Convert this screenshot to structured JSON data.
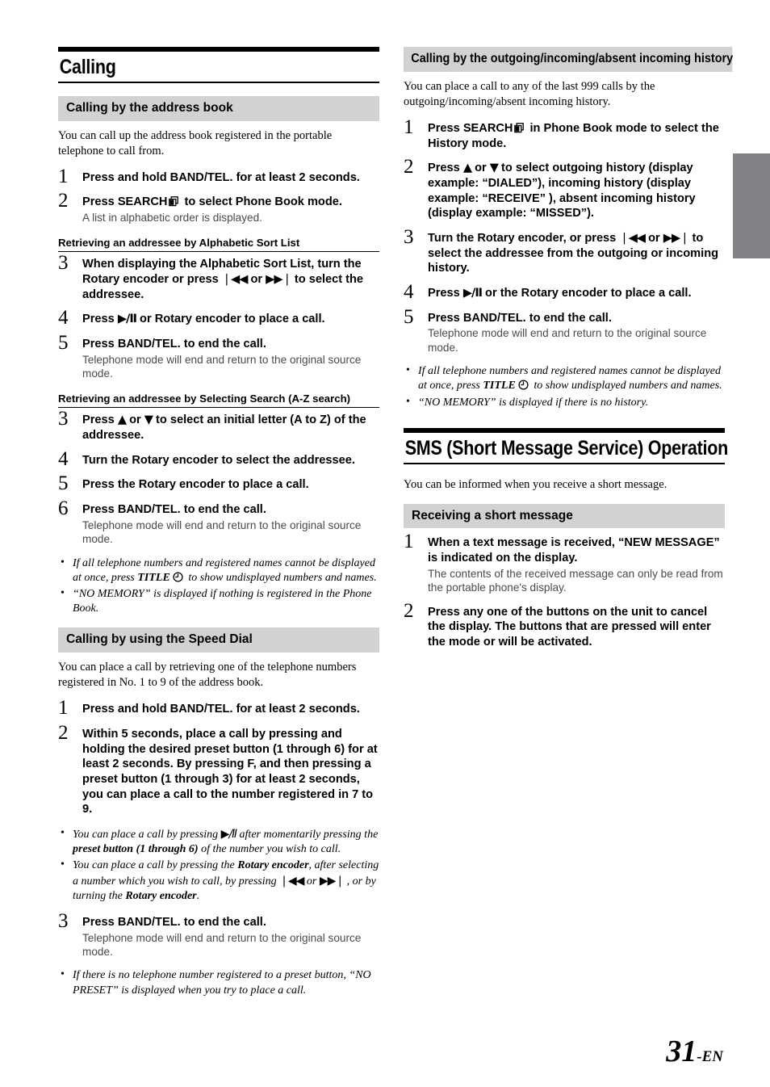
{
  "page": {
    "number": "31",
    "suffix": "-EN",
    "edge_tab_color": "#808288",
    "band_color": "#d2d2d2"
  },
  "left_column": {
    "chapter_title": "Calling",
    "section_address_book": {
      "band": "Calling by the address book",
      "intro": "You can call up the address book registered in the portable telephone to call from.",
      "steps": [
        {
          "num": "1",
          "pre": "Press and hold ",
          "bold": "BAND/TEL.",
          "post": " for at least 2 seconds.",
          "sub": ""
        },
        {
          "num": "2",
          "pre": "Press ",
          "bold": "SEARCH",
          "icon": "search-icon",
          "post": " to select Phone Book mode.",
          "sub": "A list in alphabetic order is displayed."
        }
      ],
      "subhead_alpha": "Retrieving an addressee by Alphabetic Sort List",
      "steps_alpha": [
        {
          "num": "3",
          "line1_pre": "When displaying the Alphabetic Sort List, turn the ",
          "line1_bold": "Rotary encoder",
          "line1_mid": " or press ",
          "glyph_prev": "❘◀◀",
          "line1_or": " or ",
          "glyph_next": "▶▶❘",
          "line1_post": " to select the addressee.",
          "sub": ""
        },
        {
          "num": "4",
          "pre": "Press ",
          "glyph_play": "▶/Ⅱ",
          "mid": " or ",
          "bold": "Rotary encoder",
          "post": " to place a call.",
          "sub": ""
        },
        {
          "num": "5",
          "pre": "Press ",
          "bold": "BAND/TEL.",
          "post": " to end the call.",
          "sub": "Telephone mode will end and return to the original source mode."
        }
      ],
      "subhead_az": "Retrieving an addressee by Selecting Search (A-Z search)",
      "steps_az": [
        {
          "num": "3",
          "pre": "Press ",
          "glyph_up": "▲",
          "mid": " or ",
          "glyph_down": "▼",
          "post": " to select an initial letter (A to Z) of the addressee.",
          "sub": ""
        },
        {
          "num": "4",
          "pre": "Turn the ",
          "bold": "Rotary encoder",
          "post": " to select the addressee.",
          "sub": ""
        },
        {
          "num": "5",
          "pre": "Press the ",
          "bold": "Rotary encoder",
          "post": " to place a call.",
          "sub": ""
        },
        {
          "num": "6",
          "pre": "Press ",
          "bold": "BAND/TEL.",
          "post": " to end the call.",
          "sub": "Telephone mode will end and return to the original source mode."
        }
      ],
      "notes": [
        {
          "pre": "If all telephone numbers and registered names cannot be displayed at once, press ",
          "bold": "TITLE",
          "icon": "clock-icon",
          "post": " to show undisplayed numbers and names."
        },
        {
          "pre": "“NO MEMORY” is displayed if nothing is registered in the Phone Book.",
          "bold": "",
          "post": ""
        }
      ]
    },
    "section_speed_dial": {
      "band": "Calling by using the Speed Dial",
      "intro": "You can place a call by retrieving one of the telephone numbers registered in No. 1 to 9 of the address book.",
      "steps": [
        {
          "num": "1",
          "pre": "Press and hold ",
          "bold": "BAND/TEL.",
          "post": " for at least 2 seconds.",
          "sub": ""
        },
        {
          "num": "2",
          "p1_pre": "Within 5 seconds, place a call by pressing and holding the desired ",
          "p1_bold": "preset button (1 through 6)",
          "p1_post": " for at least 2 seconds.",
          "p2_pre": "By pressing ",
          "p2_bold_f": "F",
          "p2_mid": ", and then pressing a ",
          "p2_bold": "preset button (1 through 3)",
          "p2_post": " for at least 2 seconds, you can place a call to the number registered in 7 to 9.",
          "sub": ""
        }
      ],
      "notes": [
        {
          "pre": "You can place a call by pressing ",
          "glyph": "▶/Ⅱ",
          "mid": " after momentarily pressing the ",
          "bold": "preset button (1 through 6)",
          "post": " of the number you wish to call."
        },
        {
          "pre": "You can place a call by pressing the ",
          "bold": "Rotary encoder",
          "mid": ", after selecting a number which you wish to call, by pressing ",
          "glyph_prev": "❘◀◀",
          "or": " or ",
          "glyph_next": "▶▶❘",
          "mid2": " , or by turning the ",
          "bold2": "Rotary encoder",
          "post": "."
        }
      ],
      "step_end": {
        "num": "3",
        "pre": "Press ",
        "bold": "BAND/TEL.",
        "post": " to end the call.",
        "sub": "Telephone mode will end and return to the original source mode."
      },
      "note_end": {
        "text": "If there is no telephone number registered to a preset button, “NO PRESET” is displayed when you try to place a call."
      }
    }
  },
  "right_column": {
    "section_history": {
      "band": "Calling by the outgoing/incoming/absent incoming history",
      "intro": "You can place a call to any of the last 999 calls by the outgoing/incoming/absent incoming history.",
      "steps": [
        {
          "num": "1",
          "pre": "Press ",
          "bold": "SEARCH",
          "icon": "search-icon",
          "post": " in Phone Book mode to select the History mode.",
          "sub": ""
        },
        {
          "num": "2",
          "pre": "Press ",
          "glyph_up": "▲",
          "mid": " or ",
          "glyph_down": "▼",
          "post": " to select outgoing history (display example: “DIALED”), incoming history (display example: “RECEIVE” ), absent incoming history (display example: “MISSED”).",
          "sub": ""
        },
        {
          "num": "3",
          "pre": "Turn the ",
          "bold": "Rotary encoder",
          "mid": ", or press ",
          "glyph_prev": "❘◀◀",
          "or": " or ",
          "glyph_next": "▶▶❘",
          "post": " to select the addressee from the outgoing or incoming history.",
          "sub": ""
        },
        {
          "num": "4",
          "pre": "Press ",
          "glyph_play": "▶/Ⅱ",
          "mid": " or the ",
          "bold": "Rotary encoder",
          "post": " to place a call.",
          "sub": ""
        },
        {
          "num": "5",
          "pre": "Press ",
          "bold": "BAND/TEL.",
          "post": " to end the call.",
          "sub": "Telephone mode will end and return to the original source mode."
        }
      ],
      "notes": [
        {
          "pre": "If all telephone numbers and registered names cannot be displayed at once, press ",
          "bold": "TITLE",
          "icon": "clock-icon",
          "post": " to show undisplayed numbers and names."
        },
        {
          "pre": "“NO MEMORY” is displayed if there is no history.",
          "bold": "",
          "post": ""
        }
      ]
    },
    "section_sms": {
      "chapter_title": "SMS (Short Message Service) Operation",
      "intro": "You can be informed when you receive a short message.",
      "band": "Receiving a short message",
      "steps": [
        {
          "num": "1",
          "pre": "When a text message is received, “NEW MESSAGE” is indicated on the display.",
          "sub": "The contents of the received message can only be read from the portable phone's display."
        },
        {
          "num": "2",
          "pre": "Press any one of the buttons on the unit to cancel the display. The buttons that are pressed will enter the mode or will be activated.",
          "sub": ""
        }
      ]
    }
  }
}
